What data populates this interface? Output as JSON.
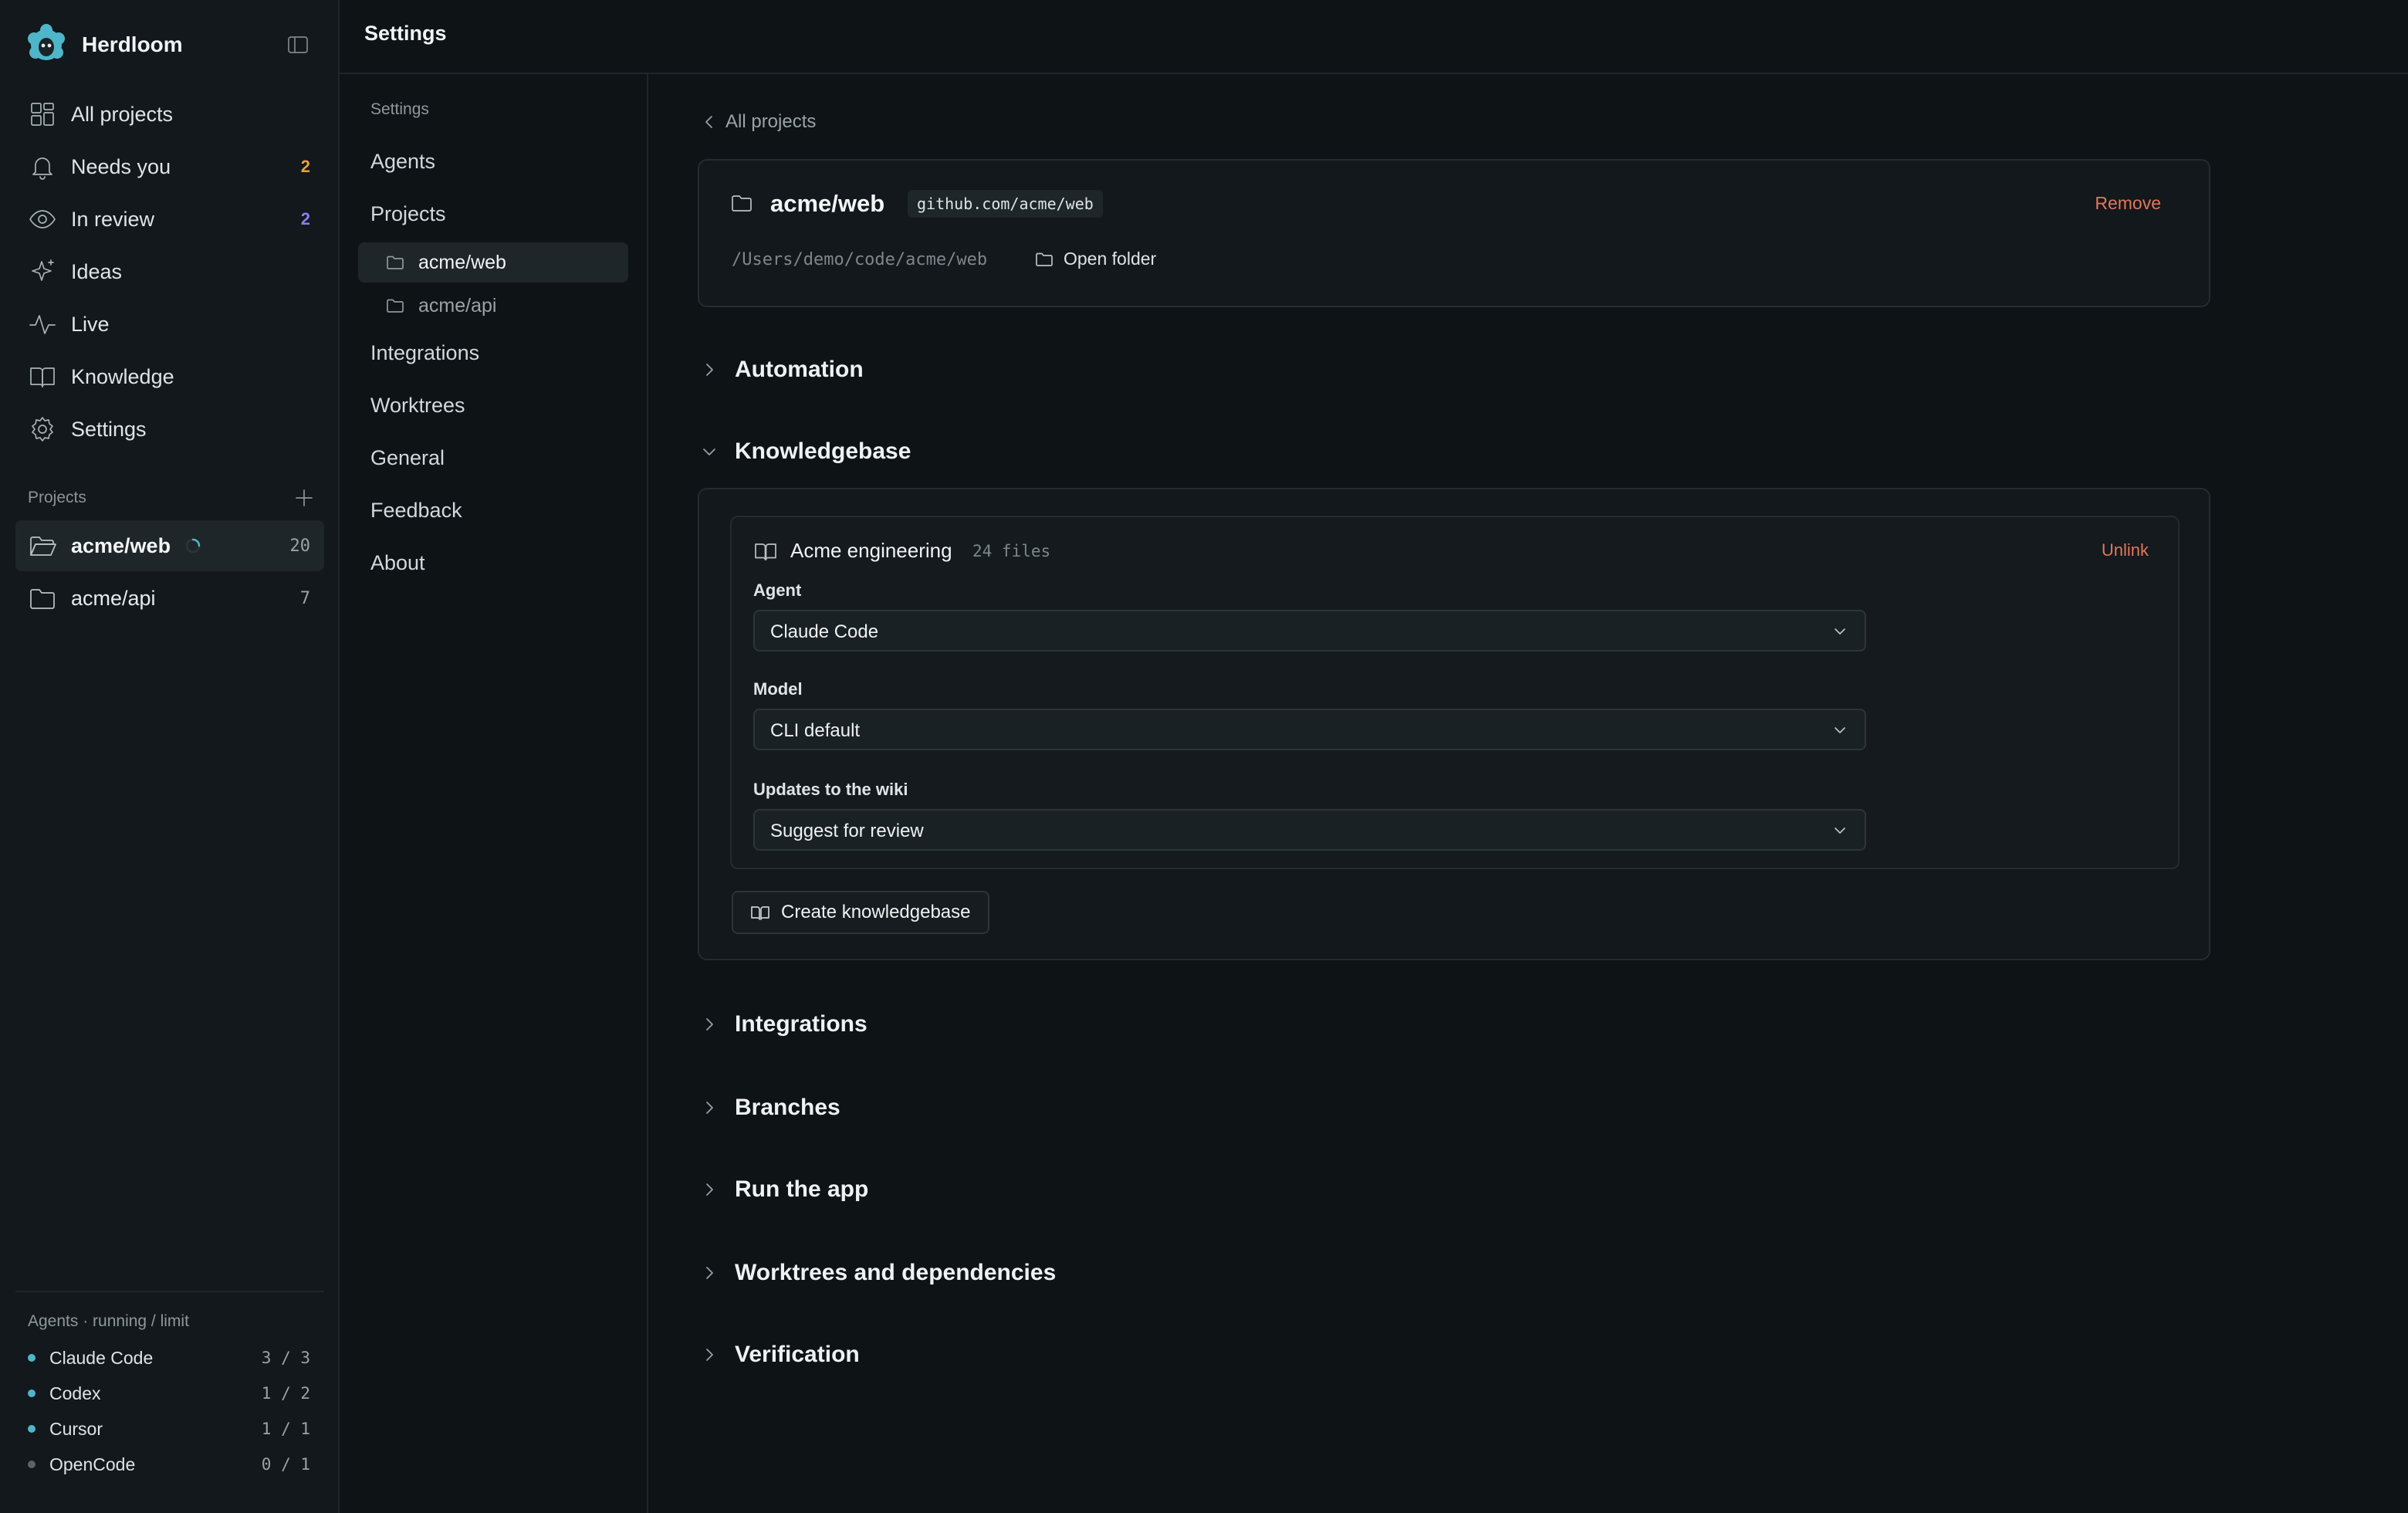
{
  "app": {
    "name": "Herdloom",
    "logo_icon": "sheep-logo-icon",
    "accent": "#4fb6c9"
  },
  "sidebar": {
    "nav": [
      {
        "label": "All projects",
        "icon": "grid-icon",
        "count": ""
      },
      {
        "label": "Needs you",
        "icon": "bell-icon",
        "count": "2",
        "count_color": "#e6a03c"
      },
      {
        "label": "In review",
        "icon": "eye-icon",
        "count": "2",
        "count_color": "#8c7cf0"
      },
      {
        "label": "Ideas",
        "icon": "sparkle-icon",
        "count": ""
      },
      {
        "label": "Live",
        "icon": "activity-icon",
        "count": ""
      },
      {
        "label": "Knowledge",
        "icon": "book-icon",
        "count": ""
      },
      {
        "label": "Settings",
        "icon": "gear-icon",
        "count": ""
      }
    ],
    "projects_heading": "Projects",
    "projects": [
      {
        "name": "acme/web",
        "count": "20",
        "active": true,
        "running": true
      },
      {
        "name": "acme/api",
        "count": "7",
        "active": false,
        "running": false
      }
    ],
    "agents_title": "Agents · running / limit",
    "agents": [
      {
        "name": "Claude Code",
        "ratio": "3 / 3",
        "status_color": "#4fb6c9"
      },
      {
        "name": "Codex",
        "ratio": "1 / 2",
        "status_color": "#4fb6c9"
      },
      {
        "name": "Cursor",
        "ratio": "1 / 1",
        "status_color": "#4fb6c9"
      },
      {
        "name": "OpenCode",
        "ratio": "0 / 1",
        "status_color": "#5a6368"
      }
    ]
  },
  "header": {
    "title": "Settings"
  },
  "settings_nav": {
    "section_label": "Settings",
    "items": [
      "Agents",
      "Projects",
      "Integrations",
      "Worktrees",
      "General",
      "Feedback",
      "About"
    ],
    "project_children": [
      {
        "name": "acme/web",
        "active": true
      },
      {
        "name": "acme/api",
        "active": false
      }
    ]
  },
  "main": {
    "back_label": "All projects",
    "repo": {
      "name": "acme/web",
      "url": "github.com/acme/web",
      "remove_label": "Remove",
      "path": "/Users/demo/code/acme/web",
      "open_folder_label": "Open folder"
    },
    "sections": {
      "automation": "Automation",
      "knowledgebase": "Knowledgebase",
      "integrations": "Integrations",
      "branches": "Branches",
      "run_app": "Run the app",
      "worktrees_deps": "Worktrees and dependencies",
      "verification": "Verification"
    },
    "knowledgebase": {
      "name": "Acme engineering",
      "files": "24 files",
      "unlink_label": "Unlink",
      "agent_label": "Agent",
      "agent_value": "Claude Code",
      "model_label": "Model",
      "model_value": "CLI default",
      "updates_label": "Updates to the wiki",
      "updates_value": "Suggest for review",
      "create_label": "Create knowledgebase"
    }
  }
}
